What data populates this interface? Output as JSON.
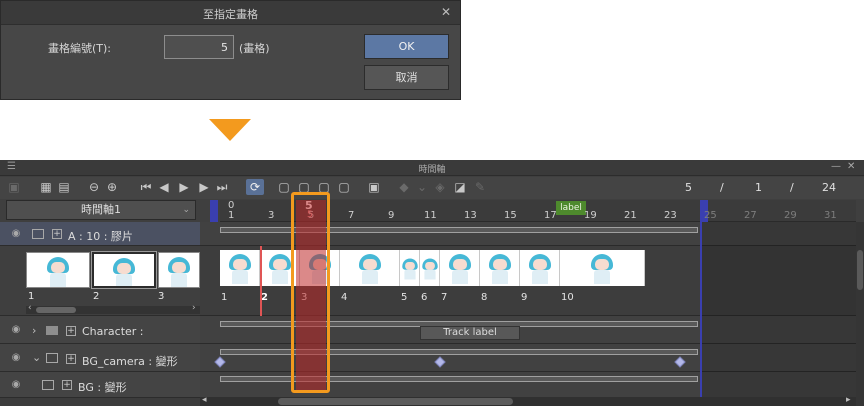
{
  "dialog": {
    "title": "至指定畫格",
    "label": "畫格編號(T):",
    "frame_value": "5",
    "unit": "(畫格)",
    "ok_label": "OK",
    "cancel_label": "取消",
    "close_icon": "close-icon"
  },
  "panel": {
    "title": "時間軸",
    "menu_icon": "menu-icon",
    "minimize_icon": "minimize-icon",
    "close_icon": "close-icon",
    "frame_counter": {
      "current": "5",
      "sep1": "/",
      "start": "1",
      "sep2": "/",
      "end": "24"
    },
    "timeline_selector": "時間軸1",
    "accent_color": "#5a7197",
    "playhead_color": "#f39a1e"
  },
  "ruler": {
    "current_frame": "5",
    "current_sub": "5",
    "start_marker": "0",
    "label_tag": "label",
    "labels": [
      "1",
      "3",
      "5",
      "7",
      "9",
      "11",
      "13",
      "15",
      "17",
      "19",
      "21",
      "23",
      "25",
      "27",
      "29",
      "31"
    ]
  },
  "layers": [
    {
      "name": "A : 10 : 膠片",
      "type": "animation-folder",
      "selected": true
    },
    {
      "name": "Character :",
      "type": "folder"
    },
    {
      "name": "BG_camera : 變形",
      "type": "camera-folder"
    },
    {
      "name": "BG : 變形",
      "type": "image-layer"
    }
  ],
  "thumbnails": [
    {
      "label": "1"
    },
    {
      "label": "2",
      "selected": true
    },
    {
      "label": "3"
    }
  ],
  "track": {
    "cel_numbers": [
      "1",
      "2",
      "3",
      "4",
      "5",
      "6",
      "7",
      "8",
      "9",
      "10"
    ],
    "track_label": "Track label"
  }
}
